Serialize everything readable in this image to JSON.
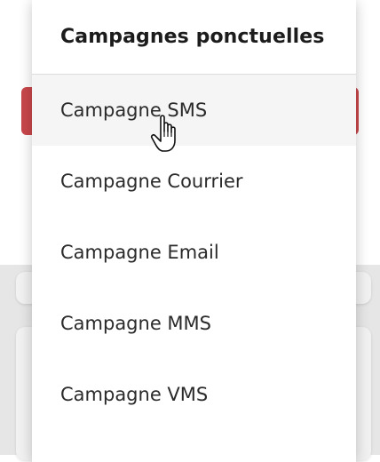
{
  "dropdown": {
    "title": "Campagnes ponctuelles",
    "items": [
      {
        "label": "Campagne SMS"
      },
      {
        "label": "Campagne Courrier"
      },
      {
        "label": "Campagne Email"
      },
      {
        "label": "Campagne MMS"
      },
      {
        "label": "Campagne VMS"
      }
    ]
  },
  "cursor": {
    "icon": "hand-pointer-icon"
  },
  "colors": {
    "accent_red": "#c8474b",
    "hover_bg": "#f5f5f5"
  }
}
